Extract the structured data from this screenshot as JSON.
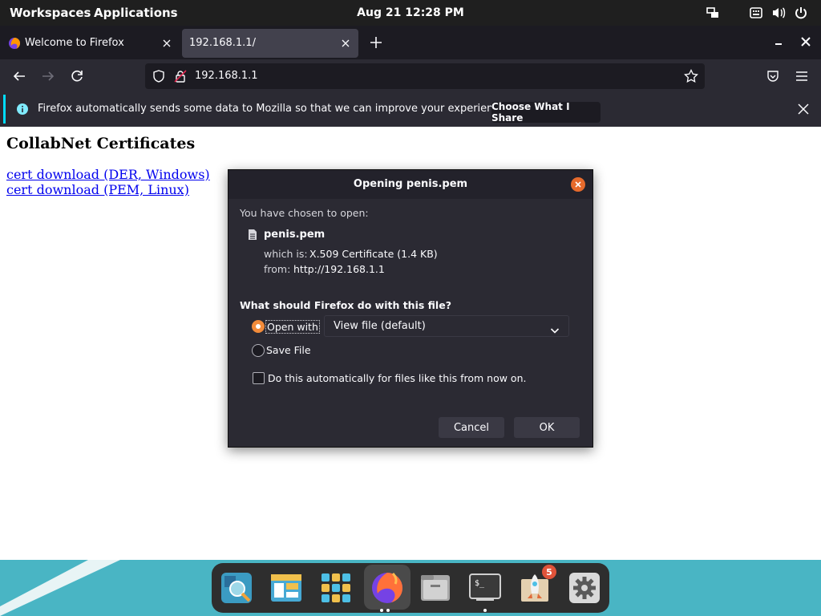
{
  "topbar": {
    "workspaces": "Workspaces",
    "applications": "Applications",
    "datetime": "Aug 21  12:28 PM",
    "tray_icons": [
      "window-tiling-icon",
      "keyboard-icon",
      "volume-icon",
      "power-icon"
    ]
  },
  "tabs": [
    {
      "title": "Welcome to Firefox",
      "icon": "firefox-icon",
      "active": false
    },
    {
      "title": "192.168.1.1/",
      "active": true
    }
  ],
  "window_controls": {
    "minimize": "–",
    "close": "✕"
  },
  "navbar": {
    "url": "192.168.1.1"
  },
  "notification": {
    "text": "Firefox automatically sends some data to Mozilla so that we can improve your experience.",
    "button": "Choose What I Share"
  },
  "page": {
    "title": "CollabNet Certificates",
    "links": [
      "cert download (DER, Windows)",
      "cert download (PEM, Linux)"
    ]
  },
  "dialog": {
    "title": "Opening penis.pem",
    "chosen_label": "You have chosen to open:",
    "filename": "penis.pem",
    "which_is_label": "which is:",
    "which_is_value": "X.509 Certificate (1.4 KB)",
    "from_label": "from:",
    "from_value": "http://192.168.1.1",
    "question": "What should Firefox do with this file?",
    "open_with_label": "Open with",
    "open_with_value": "View file (default)",
    "save_file_label": "Save File",
    "auto_label": "Do this automatically for files like this from now on.",
    "selected_option": "open_with",
    "auto_checked": false,
    "cancel": "Cancel",
    "ok": "OK"
  },
  "dock": {
    "items": [
      "search-app-icon",
      "file-manager-icon",
      "app-grid-icon",
      "firefox-icon",
      "files-icon",
      "terminal-icon",
      "rocket-icon",
      "settings-icon"
    ],
    "badge": "5"
  },
  "colors": {
    "accent": "#f28b3a",
    "dialog_bg": "#2b2a33",
    "dock_bg": "#2e2e2e",
    "desktop": "#49b5c4"
  }
}
